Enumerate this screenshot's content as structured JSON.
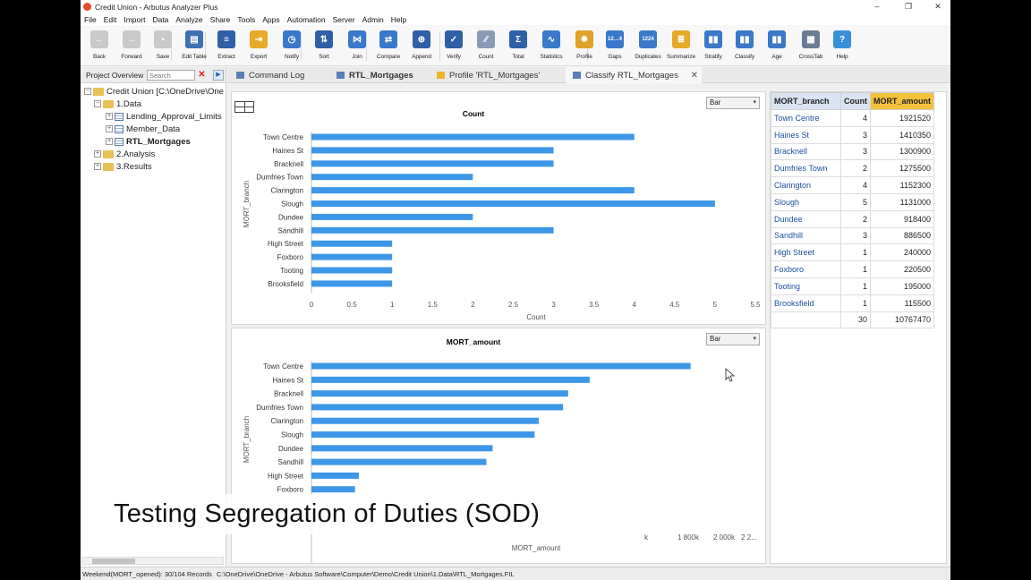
{
  "window": {
    "title": "Credit Union - Arbutus Analyzer Plus",
    "controls": [
      "–",
      "❐",
      "✕"
    ]
  },
  "menu": [
    "File",
    "Edit",
    "Import",
    "Data",
    "Analyze",
    "Share",
    "Tools",
    "Apps",
    "Automation",
    "Server",
    "Admin",
    "Help"
  ],
  "toolbar": [
    {
      "label": "Back",
      "icon": "back-arrow-icon",
      "color": "#bdbdbd",
      "glyph": "←",
      "disabled": true
    },
    {
      "label": "Forward",
      "icon": "forward-arrow-icon",
      "color": "#bdbdbd",
      "glyph": "→",
      "disabled": true
    },
    {
      "label": "Save",
      "icon": "save-icon",
      "color": "#b0b0b0",
      "glyph": "▪",
      "disabled": true
    },
    {
      "label": "Edit Table",
      "icon": "edit-table-icon",
      "color": "#3f6fb5",
      "glyph": "▤"
    },
    {
      "label": "Extract",
      "icon": "extract-icon",
      "color": "#2f5fa6",
      "glyph": "≡"
    },
    {
      "label": "Export",
      "icon": "export-icon",
      "color": "#e7a928",
      "glyph": "⇥"
    },
    {
      "label": "Notify",
      "icon": "notify-icon",
      "color": "#3a78c9",
      "glyph": "◷"
    },
    {
      "label": "Sort",
      "icon": "sort-icon",
      "color": "#2f5fa6",
      "glyph": "⇅"
    },
    {
      "label": "Join",
      "icon": "join-icon",
      "color": "#3a78c9",
      "glyph": "⋈"
    },
    {
      "label": "Compare",
      "icon": "compare-icon",
      "color": "#3a78c9",
      "glyph": "⇄"
    },
    {
      "label": "Append",
      "icon": "append-icon",
      "color": "#2f5fa6",
      "glyph": "⊕"
    },
    {
      "label": "Verify",
      "icon": "verify-icon",
      "color": "#2f5fa6",
      "glyph": "✓"
    },
    {
      "label": "Count",
      "icon": "count-icon",
      "color": "#8a9bb5",
      "glyph": "⁄⁄"
    },
    {
      "label": "Total",
      "icon": "total-icon",
      "color": "#2f5fa6",
      "glyph": "Σ"
    },
    {
      "label": "Statistics",
      "icon": "statistics-icon",
      "color": "#3a78c9",
      "glyph": "∿"
    },
    {
      "label": "Profile",
      "icon": "profile-icon",
      "color": "#e0a126",
      "glyph": "✹"
    },
    {
      "label": "Gaps",
      "icon": "gaps-icon",
      "color": "#3a78c9",
      "glyph": "12…4"
    },
    {
      "label": "Duplicates",
      "icon": "duplicates-icon",
      "color": "#3a78c9",
      "glyph": "1224"
    },
    {
      "label": "Summarize",
      "icon": "summarize-icon",
      "color": "#e7a928",
      "glyph": "≣"
    },
    {
      "label": "Stratify",
      "icon": "stratify-icon",
      "color": "#3a78c9",
      "glyph": "▮▮"
    },
    {
      "label": "Classify",
      "icon": "classify-icon",
      "color": "#3a78c9",
      "glyph": "▮▮"
    },
    {
      "label": "Age",
      "icon": "age-icon",
      "color": "#3a78c9",
      "glyph": "▮▮"
    },
    {
      "label": "CrossTab",
      "icon": "crosstab-icon",
      "color": "#6b7b93",
      "glyph": "▦"
    },
    {
      "label": "Help",
      "icon": "help-icon",
      "color": "#3a8fd9",
      "glyph": "?"
    }
  ],
  "project": {
    "header": "Project Overview",
    "search_placeholder": "Search",
    "root": "Credit Union [C:\\OneDrive\\One",
    "items": [
      {
        "label": "1.Data",
        "type": "folder",
        "level": 1,
        "expanded": true
      },
      {
        "label": "Lending_Approval_Limits",
        "type": "table",
        "level": 2
      },
      {
        "label": "Member_Data",
        "type": "table",
        "level": 2
      },
      {
        "label": "RTL_Mortgages",
        "type": "table",
        "level": 2,
        "bold": true
      },
      {
        "label": "2.Analysis",
        "type": "folder",
        "level": 1
      },
      {
        "label": "3.Results",
        "type": "folder",
        "level": 1
      }
    ]
  },
  "tabs": [
    {
      "label": "Command Log",
      "icon": "command-log-icon",
      "active": false
    },
    {
      "label": "RTL_Mortgages",
      "icon": "table-icon",
      "active": false,
      "bold": true
    },
    {
      "label": "Profile 'RTL_Mortgages'",
      "icon": "profile-icon",
      "active": false
    },
    {
      "label": "Classify RTL_Mortgages",
      "icon": "classify-icon",
      "active": true,
      "closable": true
    }
  ],
  "chart_type_select": "Bar",
  "chart_data": [
    {
      "type": "bar",
      "orientation": "horizontal",
      "title": "Count",
      "xlabel": "Count",
      "ylabel": "MORT_branch",
      "categories": [
        "Town Centre",
        "Haines St",
        "Bracknell",
        "Dumfries Town",
        "Clarington",
        "Slough",
        "Dundee",
        "Sandhill",
        "High Street",
        "Foxboro",
        "Tooting",
        "Brooksfield"
      ],
      "values": [
        4,
        3,
        3,
        2,
        4,
        5,
        2,
        3,
        1,
        1,
        1,
        1
      ],
      "xlim": [
        0,
        5.5
      ],
      "ticks": [
        "0",
        "0.5",
        "1",
        "1.5",
        "2",
        "2.5",
        "3",
        "3.5",
        "4",
        "4.5",
        "5",
        "5.5"
      ],
      "bar_color": "#3d97e8"
    },
    {
      "type": "bar",
      "orientation": "horizontal",
      "title": "MORT_amount",
      "xlabel": "MORT_amount",
      "ylabel": "MORT_branch",
      "categories": [
        "Town Centre",
        "Haines St",
        "Bracknell",
        "Dumfries Town",
        "Clarington",
        "Slough",
        "Dundee",
        "Sandhill",
        "High Street",
        "Foxboro"
      ],
      "values": [
        1921520,
        1410350,
        1300900,
        1275500,
        1152300,
        1131000,
        918400,
        886500,
        240000,
        220500
      ],
      "xlim": [
        0,
        2200000
      ],
      "ticks_visible": [
        "k",
        "1 800k",
        "2 000k",
        "2 2..."
      ],
      "bar_color": "#3d97e8"
    }
  ],
  "summary_table": {
    "headers": [
      "MORT_branch",
      "Count",
      "MORT_amount"
    ],
    "rows": [
      [
        "Town Centre",
        "4",
        "1921520"
      ],
      [
        "Haines St",
        "3",
        "1410350"
      ],
      [
        "Bracknell",
        "3",
        "1300900"
      ],
      [
        "Dumfries Town",
        "2",
        "1275500"
      ],
      [
        "Clarington",
        "4",
        "1152300"
      ],
      [
        "Slough",
        "5",
        "1131000"
      ],
      [
        "Dundee",
        "2",
        "918400"
      ],
      [
        "Sandhill",
        "3",
        "886500"
      ],
      [
        "High Street",
        "1",
        "240000"
      ],
      [
        "Foxboro",
        "1",
        "220500"
      ],
      [
        "Tooting",
        "1",
        "195000"
      ],
      [
        "Brooksfield",
        "1",
        "115500"
      ]
    ],
    "totals": [
      "",
      "30",
      "10767470"
    ]
  },
  "status": {
    "left": "Weekend(MORT_opened): 30/104 Records",
    "path": "C:\\OneDrive\\OneDrive - Arbutus Software\\Computer\\Demo\\Credit Union\\1.Data\\RTL_Mortgages.FIL"
  },
  "caption": "Testing Segregation of Duties (SOD)"
}
